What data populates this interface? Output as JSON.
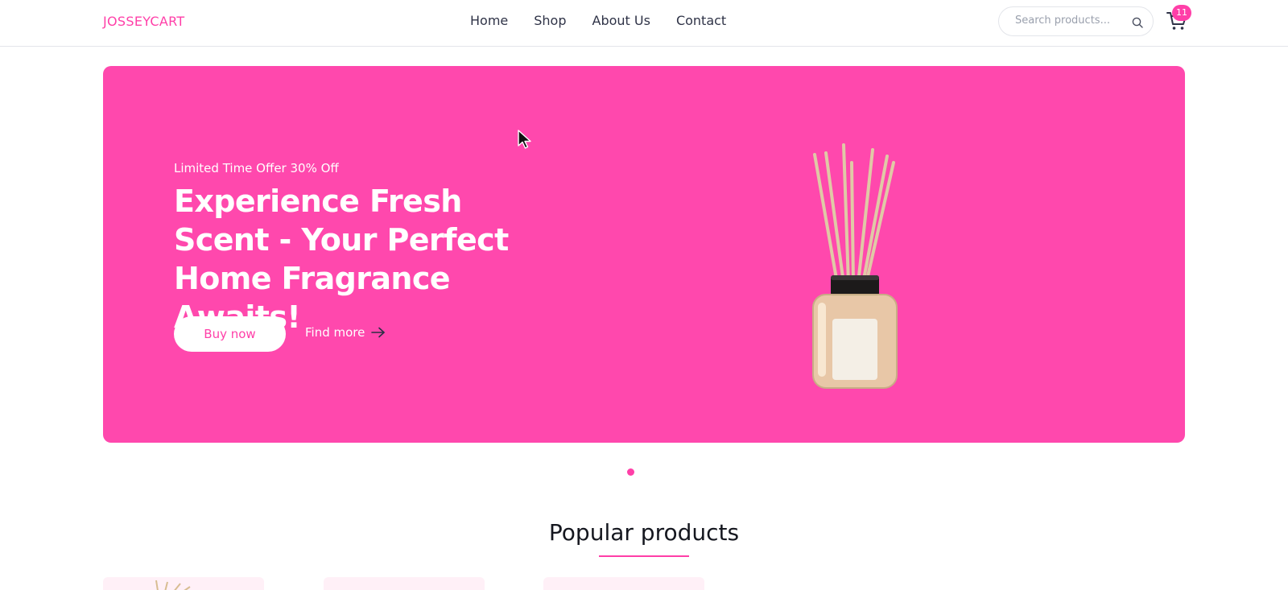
{
  "header": {
    "logo": "JOSSEYCART",
    "nav": [
      "Home",
      "Shop",
      "About Us",
      "Contact"
    ],
    "search_placeholder": "Search products...",
    "cart_count": "11"
  },
  "hero": {
    "tagline": "Limited Time Offer 30% Off",
    "title": "Experience Fresh Scent - Your Perfect Home Fragrance Awaits!",
    "buy_label": "Buy now",
    "find_label": "Find more"
  },
  "section": {
    "title": "Popular products"
  },
  "colors": {
    "brand": "#ff3fa8",
    "hero_bg": "#ff48ad"
  },
  "icons": [
    "search-icon",
    "cart-icon",
    "arrow-right-icon"
  ]
}
